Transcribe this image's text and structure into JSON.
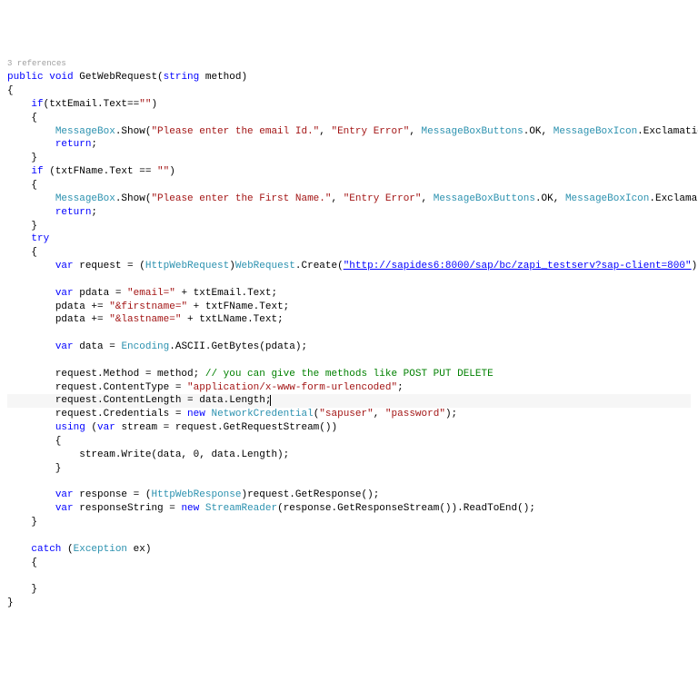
{
  "refs": "3 references",
  "sig": {
    "public": "public",
    "void": "void",
    "name": " GetWebRequest(",
    "string": "string",
    "param": " method)"
  },
  "if1": {
    "if_kw": "if",
    "cond": "(txtEmail.Text==",
    "empty": "\"\"",
    "close": ")",
    "mb": "MessageBox",
    "show": ".Show(",
    "msg": "\"Please enter the email Id.\"",
    "c1": ", ",
    "title": "\"Entry Error\"",
    "c2": ", ",
    "mbb": "MessageBoxButtons",
    "ok": ".OK, ",
    "mbi": "MessageBoxIcon",
    "exc": ".Exclamation);",
    "ret": "return"
  },
  "if2": {
    "if_kw": "if",
    "cond": " (txtFName.Text == ",
    "empty": "\"\"",
    "close": ")",
    "mb": "MessageBox",
    "show": ".Show(",
    "msg": "\"Please enter the First Name.\"",
    "c1": ", ",
    "title": "\"Entry Error\"",
    "c2": ", ",
    "mbb": "MessageBoxButtons",
    "ok": ".OK, ",
    "mbi": "MessageBoxIcon",
    "exc": ".Exclamation);",
    "ret": "return"
  },
  "try_kw": "try",
  "req": {
    "var": "var",
    "a": " request = (",
    "hwr": "HttpWebRequest",
    "b": ")",
    "wr": "WebRequest",
    "c": ".Create(",
    "url": "\"http://sapides6:8000/sap/bc/zapi_testserv?sap-client=800\"",
    "d": ");"
  },
  "pd1": {
    "var": "var",
    "a": " pdata = ",
    "s": "\"email=\"",
    "b": " + txtEmail.Text;"
  },
  "pd2": {
    "a": "pdata += ",
    "s": "\"&firstname=\"",
    "b": " + txtFName.Text;"
  },
  "pd3": {
    "a": "pdata += ",
    "s": "\"&lastname=\"",
    "b": " + txtLName.Text;"
  },
  "dat": {
    "var": "var",
    "a": " data = ",
    "enc": "Encoding",
    "b": ".ASCII.GetBytes(pdata);"
  },
  "rm": {
    "a": "request.Method = method; ",
    "cmt": "// you can give the methods like POST PUT DELETE"
  },
  "rct": {
    "a": "request.ContentType = ",
    "s": "\"application/x-www-form-urlencoded\"",
    "b": ";"
  },
  "rcl": "request.ContentLength = data.Length;",
  "rcr": {
    "a": "request.Credentials = ",
    "new": "new",
    "b": " ",
    "nc": "NetworkCredential",
    "c": "(",
    "u": "\"sapuser\"",
    "d": ", ",
    "p": "\"password\"",
    "e": ");"
  },
  "us": {
    "using": "using",
    "a": " (",
    "var": "var",
    "b": " stream = request.GetRequestStream())"
  },
  "sw": "stream.Write(data, 0, data.Length);",
  "resp": {
    "var": "var",
    "a": " response = (",
    "hwr": "HttpWebResponse",
    "b": ")request.GetResponse();"
  },
  "rs": {
    "var": "var",
    "a": " responseString = ",
    "new": "new",
    "b": " ",
    "sr": "StreamReader",
    "c": "(response.GetResponseStream()).ReadToEnd();"
  },
  "catch": {
    "kw": "catch",
    "a": " (",
    "ex": "Exception",
    "b": " ex)"
  }
}
